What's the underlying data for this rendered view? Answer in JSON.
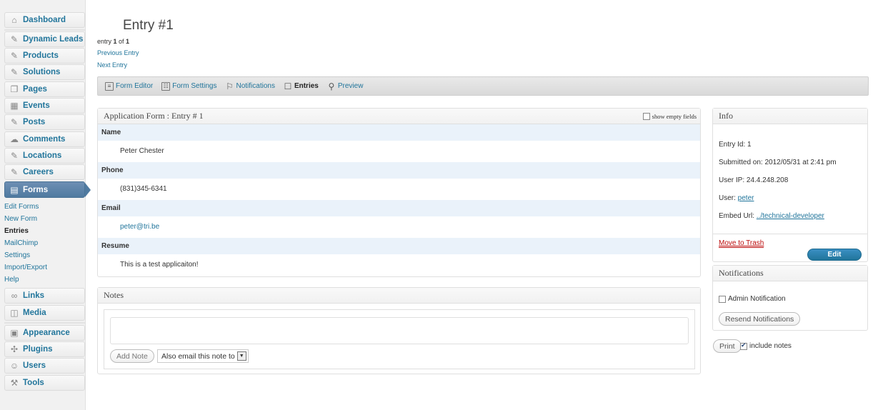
{
  "sidebar": {
    "items": [
      {
        "label": "Dashboard",
        "icon": "⌂"
      },
      {
        "label": "Dynamic Leads",
        "icon": "✎"
      },
      {
        "label": "Products",
        "icon": "✎"
      },
      {
        "label": "Solutions",
        "icon": "✎"
      },
      {
        "label": "Pages",
        "icon": "❐"
      },
      {
        "label": "Events",
        "icon": "▦"
      },
      {
        "label": "Posts",
        "icon": "✎"
      },
      {
        "label": "Comments",
        "icon": "☁"
      },
      {
        "label": "Locations",
        "icon": "✎"
      },
      {
        "label": "Careers",
        "icon": "✎"
      },
      {
        "label": "Forms",
        "icon": "▤"
      },
      {
        "label": "Links",
        "icon": "∞"
      },
      {
        "label": "Media",
        "icon": "◫"
      },
      {
        "label": "Appearance",
        "icon": "▣"
      },
      {
        "label": "Plugins",
        "icon": "✣"
      },
      {
        "label": "Users",
        "icon": "☺"
      },
      {
        "label": "Tools",
        "icon": "⚒"
      }
    ],
    "forms_submenu": [
      "Edit Forms",
      "New Form",
      "Entries",
      "MailChimp",
      "Settings",
      "Import/Export",
      "Help"
    ]
  },
  "header": {
    "title": "Entry #1",
    "entry_prefix": "entry ",
    "entry_current": "1",
    "entry_of": " of ",
    "entry_total": "1",
    "previous": "Previous Entry",
    "next": "Next Entry"
  },
  "toolbar": {
    "items": [
      {
        "label": "Form Editor",
        "icon": "≡"
      },
      {
        "label": "Form Settings",
        "icon": "☷"
      },
      {
        "label": "Notifications",
        "icon": "⚐"
      },
      {
        "label": "Entries",
        "icon": "☐"
      },
      {
        "label": "Preview",
        "icon": "⚲"
      }
    ]
  },
  "entry": {
    "title": "Application Form : Entry # 1",
    "show_empty_label": "show empty fields",
    "fields": [
      {
        "label": "Name",
        "value": "Peter Chester"
      },
      {
        "label": "Phone",
        "value": "(831)345-6341"
      },
      {
        "label": "Email",
        "value": "peter@tri.be"
      },
      {
        "label": "Resume",
        "value": "This is a test applicaiton!"
      }
    ]
  },
  "notes": {
    "title": "Notes",
    "textarea_value": "",
    "add_button": "Add Note",
    "email_select": "Also email this note to"
  },
  "info": {
    "title": "Info",
    "entry_id": "Entry Id: 1",
    "submitted": "Submitted on: 2012/05/31 at 2:41 pm",
    "user_ip": "User IP: 24.4.248.208",
    "user_label": "User: ",
    "user_value": "peter",
    "embed_label": "Embed Url: ",
    "embed_value": "../technical-developer",
    "trash": "Move to Trash",
    "edit": "Edit"
  },
  "notifications": {
    "title": "Notifications",
    "admin_label": "Admin Notification",
    "resend": "Resend Notifications"
  },
  "print": {
    "button": "Print",
    "include_notes": "include notes"
  }
}
